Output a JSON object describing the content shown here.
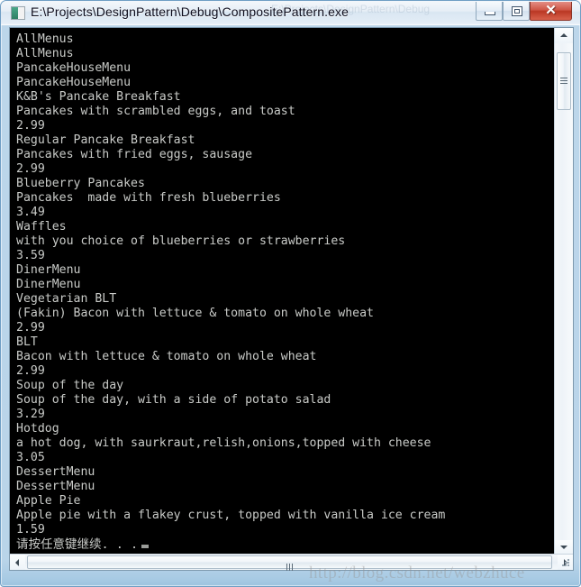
{
  "window": {
    "title": "E:\\Projects\\DesignPattern\\Debug\\CompositePattern.exe",
    "ghost_title": "E:\\Projects\\DesignPattern\\Debug",
    "icon": "console-app-icon",
    "buttons": {
      "minimize": "minimize-icon",
      "maximize": "restore-icon",
      "close": "✕"
    }
  },
  "console": {
    "lines": [
      "AllMenus",
      "AllMenus",
      "PancakeHouseMenu",
      "PancakeHouseMenu",
      "K&B's Pancake Breakfast",
      "Pancakes with scrambled eggs, and toast",
      "2.99",
      "Regular Pancake Breakfast",
      "Pancakes with fried eggs, sausage",
      "2.99",
      "Blueberry Pancakes",
      "Pancakes  made with fresh blueberries",
      "3.49",
      "Waffles",
      "with you choice of blueberries or strawberries",
      "3.59",
      "DinerMenu",
      "DinerMenu",
      "Vegetarian BLT",
      "(Fakin) Bacon with lettuce & tomato on whole wheat",
      "2.99",
      "BLT",
      "Bacon with lettuce & tomato on whole wheat",
      "2.99",
      "Soup of the day",
      "Soup of the day, with a side of potato salad",
      "3.29",
      "Hotdog",
      "a hot dog, with saurkraut,relish,onions,topped with cheese",
      "3.05",
      "DessertMenu",
      "DessertMenu",
      "Apple Pie",
      "Apple pie with a flakey crust, topped with vanilla ice cream",
      "1.59"
    ],
    "prompt_line": "请按任意键继续. . .",
    "cursor": "cursor-block",
    "foreground_color": "#c9cbc8",
    "background_color": "#000000"
  },
  "scrollbars": {
    "vertical": {
      "up_arrow": "chevron-up-icon",
      "down_arrow": "chevron-down-icon",
      "thumb": "vertical-scroll-thumb"
    },
    "horizontal": {
      "left_arrow": "chevron-left-icon",
      "right_arrow": "chevron-right-icon",
      "thumb": "horizontal-scroll-thumb"
    }
  },
  "watermark": {
    "text": "http://blog.csdn.net/webzhuce"
  }
}
